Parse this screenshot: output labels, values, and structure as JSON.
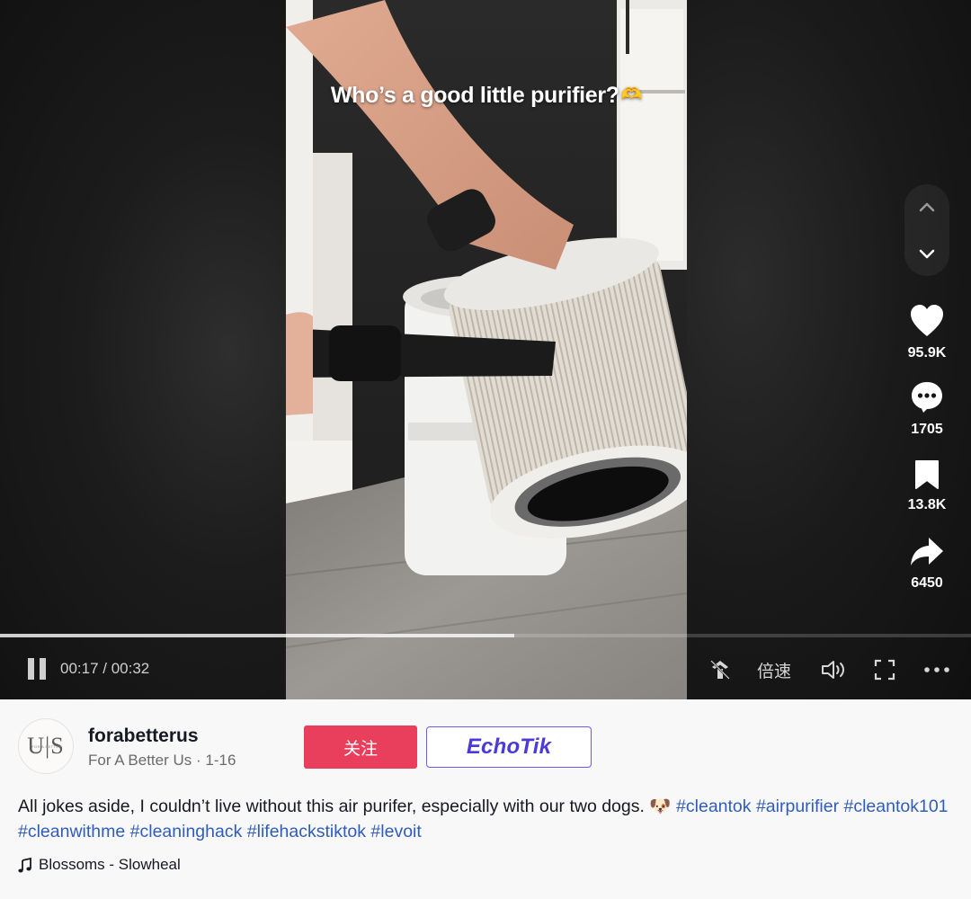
{
  "video": {
    "caption": "Who’s a good little purifier?",
    "caption_emoji": "🫶",
    "time": "00:17 / 00:32",
    "progress": 0.53,
    "speed_label": "倍速"
  },
  "actions": {
    "likes": "95.9K",
    "comments": "1705",
    "saves": "13.8K",
    "shares": "6450"
  },
  "author": {
    "avatar_text": "U|S",
    "avatar_subtext": "FOR A BETTER",
    "handle": "forabetterus",
    "subline": "For A Better Us · 1-16",
    "follow_label": "关注",
    "plugin_label": "EchoTik"
  },
  "post": {
    "text": "All jokes aside, I couldn’t live without this air purifer, especially with our two dogs. 🐶",
    "hashtags": [
      "#cleantok",
      "#airpurifier",
      "#cleantok101",
      "#cleanwithme",
      "#cleaninghack",
      "#lifehackstiktok",
      "#levoit"
    ],
    "music": "Blossoms - Slowheal"
  },
  "colors": {
    "follow": "#ea3f5c",
    "hashtag": "#2f5cbd",
    "plugin": "#4b39d8"
  }
}
